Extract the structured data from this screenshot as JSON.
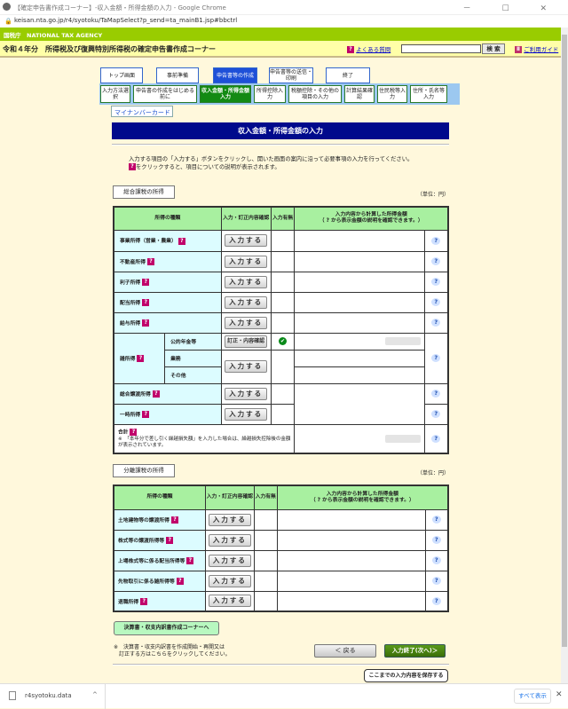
{
  "browser": {
    "title": "【確定申告書作成コーナー】-収入金額・所得金額の入力 - Google Chrome",
    "url": "keisan.nta.go.jp/r4/syotoku/TaMapSelect?p_send=ta_mainB1.jsp#bbctrl",
    "controls": "－ ☐ ✕"
  },
  "header": {
    "agency": "国税庁　NATIONAL TAX AGENCY",
    "title": "令和４年分　所得税及び復興特別所得税の確定申告書作成コーナー",
    "faq": "よくある質問",
    "search_value": "",
    "search_button": "検 索",
    "guide": "ご利用ガイド",
    "help_badge": "?"
  },
  "steps": [
    "トップ画面",
    "事前準備",
    "申告書等の作成",
    "申告書等の送信・印刷",
    "終了"
  ],
  "substeps": [
    "入力方法選択",
    "申告書の作成をはじめる前に",
    "収入金額・所得金額入力",
    "所得控除入力",
    "税額控除・その他の項目の入力",
    "計算結果確認",
    "住民税等入力",
    "住所・氏名等入力"
  ],
  "mynumber": "マイナンバーカード",
  "page_title": "収入金額・所得金額の入力",
  "intro": {
    "line1": "入力する項目の「入力する」ボタンをクリックし、開いた画面の案内に沿って必要事項の入力を行ってください。",
    "line2": "をクリックすると、項目についての説明が表示されます。"
  },
  "sogo": {
    "section": "総合課税の所得",
    "unit": "（単位：円）",
    "headers": {
      "type": "所得の種類",
      "input": "入力・訂正内容確認",
      "status": "入力有無",
      "amount": "入力内容から計算した所得金額",
      "amount_note": "（ ? から表示金額の説明を確認できます。）"
    },
    "rows": [
      {
        "label": "事業所得（営業・農業）"
      },
      {
        "label": "不動産所得"
      },
      {
        "label": "利子所得"
      },
      {
        "label": "配当所得"
      },
      {
        "label": "給与所得"
      }
    ],
    "misc": {
      "label": "雑所得",
      "sub": [
        "公的年金等",
        "業務",
        "その他"
      ],
      "edit_button": "訂正・内容確認"
    },
    "rows2": [
      {
        "label": "総合譲渡所得"
      },
      {
        "label": "一時所得"
      }
    ],
    "total": {
      "label": "合計",
      "note": "※　「本年分で差し引く繰越損失額」を入力した場合は、繰越損失控除後の金額が表示されています。"
    },
    "input_button": "入力する"
  },
  "bunri": {
    "section": "分離課税の所得",
    "unit": "（単位：円）",
    "rows": [
      {
        "label": "土地建物等の譲渡所得"
      },
      {
        "label": "株式等の譲渡所得等"
      },
      {
        "label": "上場株式等に係る配当所得等"
      },
      {
        "label": "先物取引に係る雑所得等"
      },
      {
        "label": "退職所得"
      }
    ]
  },
  "footer": {
    "kessan": "決算書・収支内訳書作成コーナーへ",
    "note1": "※　決算書・収支内訳書を作成開始・再開又は",
    "note2": "　訂正する方はこちらをクリックしてください。",
    "back": "＜ 戻る",
    "next": "入力終了(次へ)＞",
    "save": "ここまでの入力内容を保存する"
  },
  "download": {
    "file": "r4syotoku.data",
    "show_all": "すべて表示"
  }
}
